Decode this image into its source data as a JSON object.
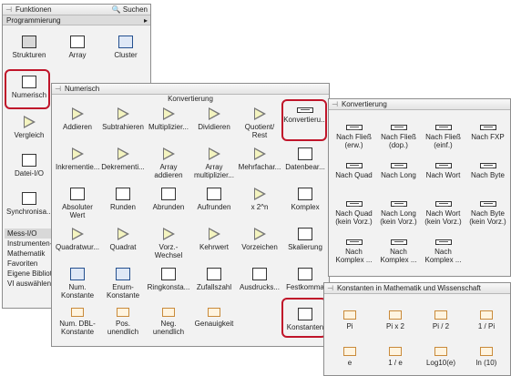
{
  "functions": {
    "title": "Funktionen",
    "search_label": "Suchen",
    "section": "Programmierung",
    "items": [
      {
        "label": "Strukturen",
        "icon": "structures-icon"
      },
      {
        "label": "Array",
        "icon": "array-icon"
      },
      {
        "label": "Cluster",
        "icon": "cluster-icon"
      },
      {
        "label": "Numerisch",
        "icon": "numeric-icon"
      },
      {
        "label": "Vergleich",
        "icon": "comparison-icon"
      },
      {
        "label": "Datei-I/O",
        "icon": "file-io-icon"
      },
      {
        "label": "Synchronisa...",
        "icon": "sync-icon"
      }
    ],
    "menu": [
      "Mess-I/O",
      "Instrumenten-I/...",
      "Mathematik",
      "Favoriten",
      "Eigene Bibliotheken",
      "VI auswählen..."
    ]
  },
  "numeric": {
    "title": "Numerisch",
    "section": "Konvertierung",
    "items": [
      "Addieren",
      "Subtrahieren",
      "Multiplizier...",
      "Dividieren",
      "Quotient/ Rest",
      "Konvertieru...",
      "Inkrementie...",
      "Dekrementi...",
      "Array addieren",
      "Array multiplizier...",
      "Mehrfachar...",
      "Datenbear...",
      "Absoluter Wert",
      "Runden",
      "Abrunden",
      "Aufrunden",
      "x 2^n",
      "Komplex",
      "Quadratwur...",
      "Quadrat",
      "Vorz.- Wechsel",
      "Kehrwert",
      "Vorzeichen",
      "Skalierung",
      "Num. Konstante",
      "Enum- Konstante",
      "Ringkonsta...",
      "Zufallszahl",
      "Ausdrucks...",
      "Festkomma",
      "Num. DBL- Konstante",
      "Pos. unendlich",
      "Neg. unendlich",
      "Genauigkeit",
      "",
      "Konstanten"
    ]
  },
  "conversion": {
    "title": "Konvertierung",
    "items": [
      "Nach Fließ (erw.)",
      "Nach Fließ (dop.)",
      "Nach Fließ (einf.)",
      "Nach FXP",
      "Nach Quad",
      "Nach Long",
      "Nach Wort",
      "Nach Byte",
      "Nach Quad (kein Vorz.)",
      "Nach Long (kein Vorz.)",
      "Nach Wort (kein Vorz.)",
      "Nach Byte (kein Vorz.)",
      "Nach Komplex ...",
      "Nach Komplex ...",
      "Nach Komplex ...",
      ""
    ]
  },
  "constants": {
    "title": "Konstanten in Mathematik und Wissenschaft",
    "items": [
      "Pi",
      "Pi x 2",
      "Pi / 2",
      "1 / Pi",
      "e",
      "1 / e",
      "Log10(e)",
      "ln (10)"
    ]
  },
  "colors": {
    "highlight": "#c0152a",
    "panel": "#f2f2f2",
    "titlebar": "#e8e8e8"
  }
}
